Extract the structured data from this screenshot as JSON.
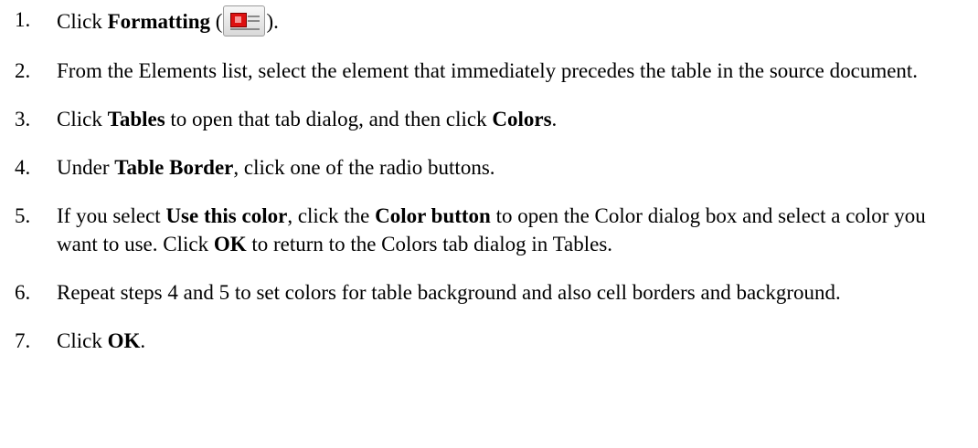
{
  "steps": [
    {
      "num": "1.",
      "parts": {
        "a": "Click ",
        "b1": "Formatting",
        "c": " (",
        "d": ")."
      },
      "icon": "formatting-icon"
    },
    {
      "num": "2.",
      "text": "From the Elements list, select the element that immediately precedes the table in the source document."
    },
    {
      "num": "3.",
      "parts": {
        "a": "Click ",
        "b1": "Tables",
        "c": " to open that tab dialog, and then click ",
        "b2": "Colors",
        "d": "."
      }
    },
    {
      "num": "4.",
      "parts": {
        "a": "Under ",
        "b1": "Table Border",
        "c": ", click one of the radio buttons."
      }
    },
    {
      "num": "5.",
      "parts": {
        "a": "If you select ",
        "b1": "Use this color",
        "c": ", click the ",
        "b2": "Color button",
        "d": " to open the Color dialog box and select a color you want to use. Click ",
        "b3": "OK",
        "e": " to return to the Colors tab dialog in Tables."
      }
    },
    {
      "num": "6.",
      "text": "Repeat steps 4 and 5 to set colors for table background and also cell borders and background."
    },
    {
      "num": "7.",
      "parts": {
        "a": "Click ",
        "b1": "OK",
        "c": "."
      }
    }
  ],
  "colors": {
    "text": "#000000",
    "background": "#ffffff",
    "icon_red": "#dd1111"
  }
}
